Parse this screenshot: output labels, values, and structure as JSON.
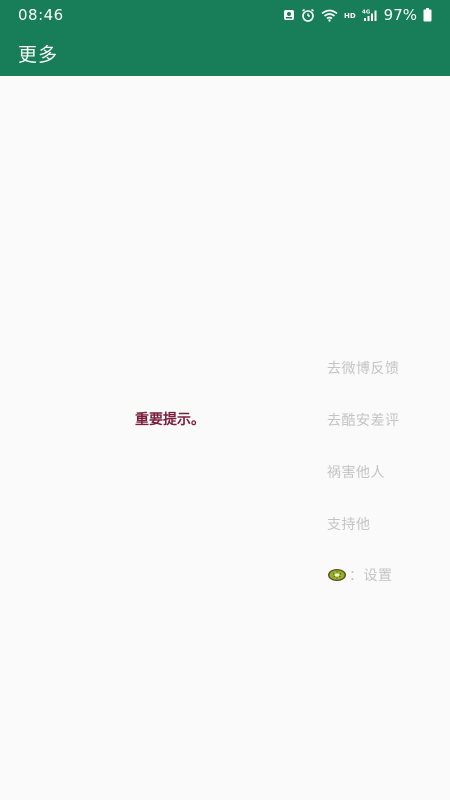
{
  "status_bar": {
    "time": "08:46",
    "battery_text": "97%",
    "icons": [
      "notification-icon",
      "alarm-icon",
      "wifi-icon",
      "hd-icon",
      "4g-signal-icon",
      "battery-icon"
    ]
  },
  "app_bar": {
    "title": "更多"
  },
  "content": {
    "notice": "重要提示。",
    "menu": {
      "item1": "去微博反馈",
      "item2": "去酷安差评",
      "item3": "祸害他人",
      "item4": "支持他",
      "settings_label": "：设置"
    }
  },
  "colors": {
    "primary": "#177e59",
    "background": "#fafafa",
    "notice": "#7a1f3a",
    "menu_text": "#c4c4c4"
  }
}
